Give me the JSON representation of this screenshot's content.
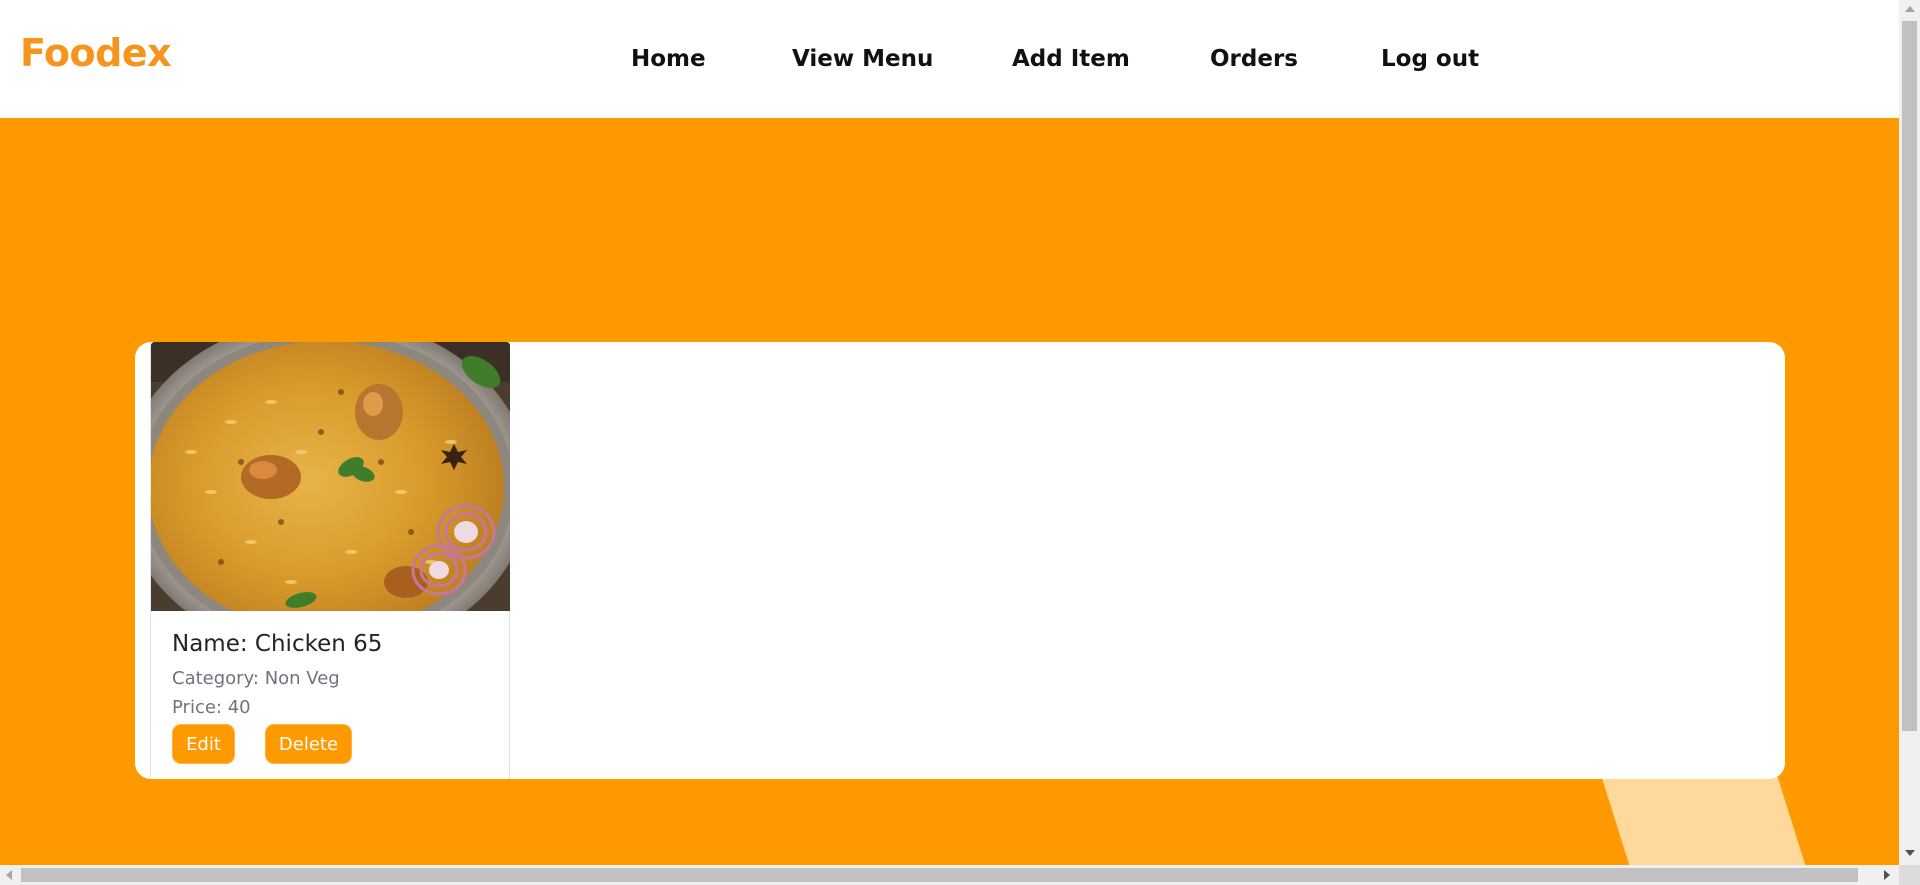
{
  "navbar": {
    "brand": "Foodex",
    "items": [
      {
        "label": "Home"
      },
      {
        "label": "View Menu"
      },
      {
        "label": "Add Item"
      },
      {
        "label": "Orders"
      },
      {
        "label": "Log out"
      }
    ]
  },
  "menu": {
    "items": [
      {
        "name": "Name: Chicken 65",
        "category": "Category: Non Veg",
        "price": "Price: 40",
        "edit_label": "Edit",
        "delete_label": "Delete",
        "image_icon": "biryani-photo"
      }
    ]
  },
  "colors": {
    "brand": "#f7941d",
    "background": "#ff9900",
    "button": "#ff9900",
    "deco": "#ffd89c"
  }
}
